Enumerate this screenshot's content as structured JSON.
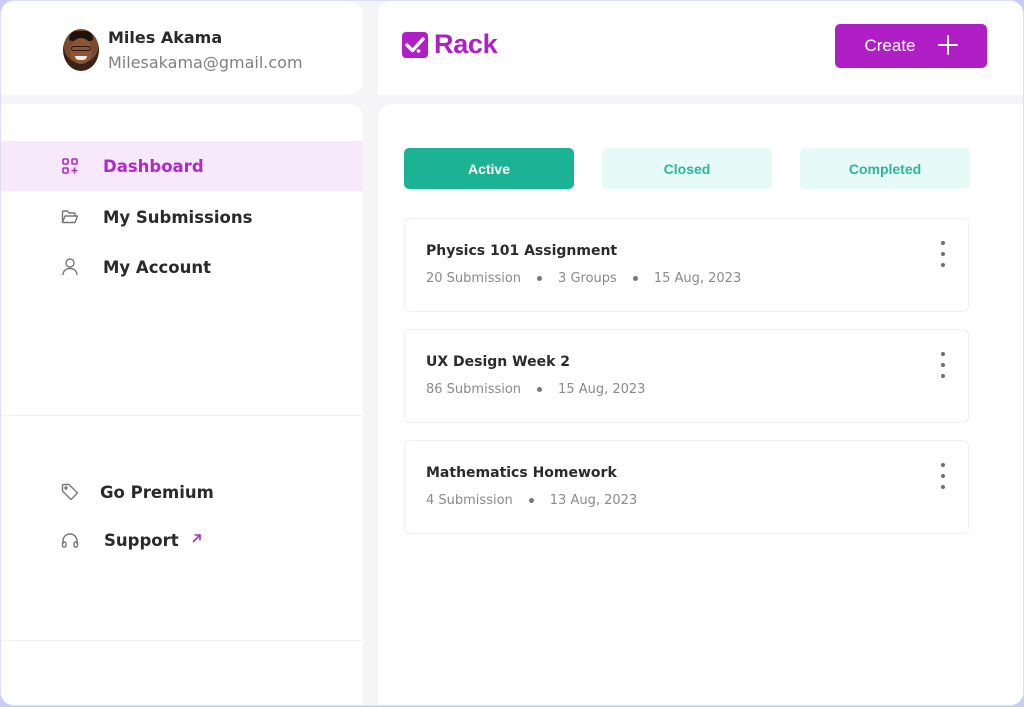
{
  "profile": {
    "name": "Miles Akama",
    "email": "Milesakama@gmail.com",
    "avatar_icon": "user-photo"
  },
  "brand": {
    "name": "Rack",
    "icon": "checkbox-check-icon",
    "color": "#b01ec6"
  },
  "header": {
    "create_label": "Create",
    "create_icon": "plus-icon"
  },
  "sidebar": {
    "items": [
      {
        "label": "Dashboard",
        "icon": "grid-add-icon",
        "active": true
      },
      {
        "label": "My Submissions",
        "icon": "folder-open-icon",
        "active": false
      },
      {
        "label": "My Account",
        "icon": "user-icon",
        "active": false
      }
    ],
    "bottom_items": [
      {
        "label": "Go Premium",
        "icon": "tag-icon"
      },
      {
        "label": "Support",
        "icon": "headphones-icon",
        "trailing_icon": "arrow-up-right-icon"
      }
    ]
  },
  "tabs": [
    {
      "label": "Active",
      "selected": true
    },
    {
      "label": "Closed",
      "selected": false
    },
    {
      "label": "Completed",
      "selected": false
    }
  ],
  "assignments": [
    {
      "title": "Physics 101 Assignment",
      "meta": [
        "20 Submission",
        "3 Groups",
        "15 Aug, 2023"
      ]
    },
    {
      "title": "UX Design Week 2",
      "meta": [
        "86 Submission",
        "15 Aug, 2023"
      ]
    },
    {
      "title": "Mathematics Homework",
      "meta": [
        "4 Submission",
        "13 Aug, 2023"
      ]
    }
  ],
  "colors": {
    "accent": "#b01ec6",
    "active_tab": "#1bb394",
    "inactive_tab_bg": "#e6faf7",
    "inactive_tab_text": "#2fb59a",
    "nav_active_bg": "#f7e8fb"
  }
}
